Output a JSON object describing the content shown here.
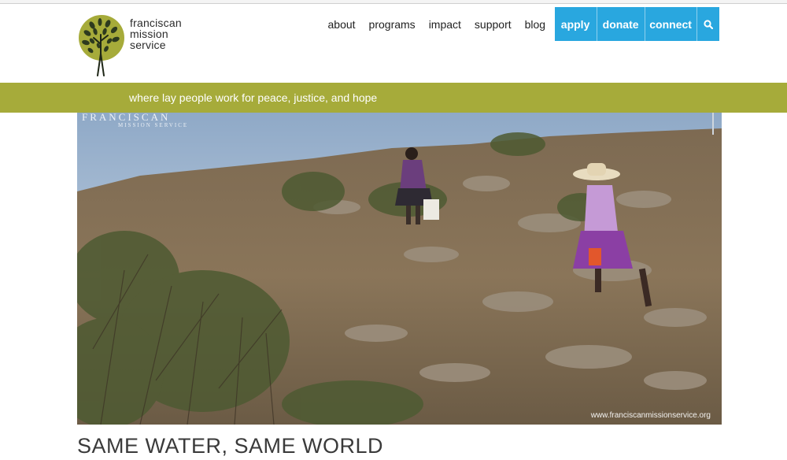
{
  "logo": {
    "lines": [
      "franciscan",
      "mission",
      "service"
    ],
    "mark_color": "#a6ab3a"
  },
  "nav": {
    "links": [
      "about",
      "programs",
      "impact",
      "support",
      "blog"
    ],
    "cta": [
      "apply",
      "donate",
      "connect"
    ],
    "search_icon": "search-icon",
    "cta_color": "#29a7df"
  },
  "tagline": "where lay people work for peace, justice, and hope",
  "tagline_color": "#a6ab3a",
  "hero": {
    "watermark_top": "FRANCISCAN",
    "watermark_sub": "MISSION SERVICE",
    "watermark_url": "www.franciscanmissionservice.org"
  },
  "headline": "SAME WATER, SAME WORLD"
}
